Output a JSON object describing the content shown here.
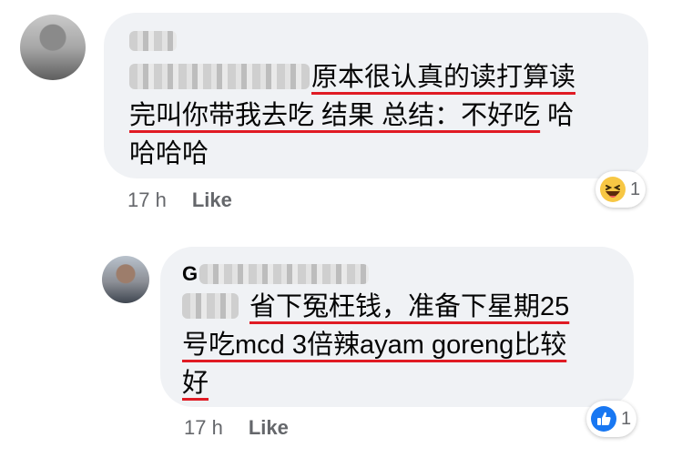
{
  "comments": [
    {
      "time": "17 h",
      "like_label": "Like",
      "text_line1": "原本很认真的读打算读",
      "text_line2": "完叫你带我去吃 结果 总结：不好吃",
      "text_line2_tail": " 哈",
      "text_line3": "哈哈哈",
      "reaction": {
        "icon": "haha-emoji-icon",
        "count": "1"
      }
    },
    {
      "name_initial": "G",
      "time": "17 h",
      "like_label": "Like",
      "text_line1": "省下冤枉钱，准备下星期25",
      "text_line2": "号吃mcd 3倍辣ayam goreng比较",
      "text_line3": "好",
      "reaction": {
        "icon": "like-thumb-icon",
        "count": "1"
      }
    }
  ],
  "colors": {
    "bubble": "#f0f2f5",
    "underline": "#e01b24",
    "meta": "#65676b",
    "like_blue": "#1877f2"
  }
}
